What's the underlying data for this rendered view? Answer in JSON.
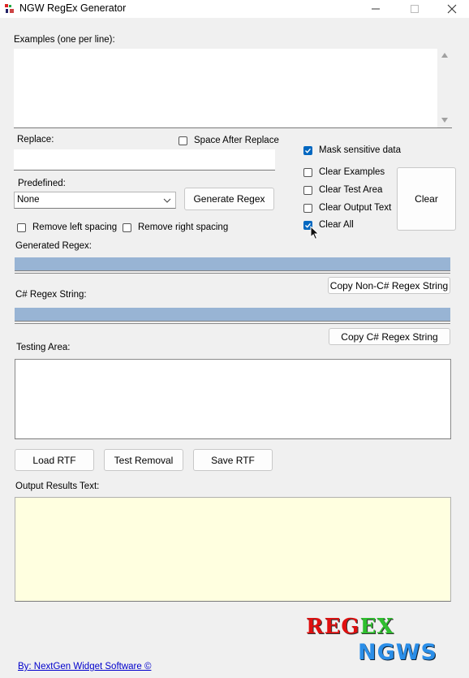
{
  "window": {
    "title": "NGW RegEx Generator"
  },
  "examples": {
    "label": "Examples (one per line):",
    "value": ""
  },
  "replace": {
    "label": "Replace:",
    "value": "",
    "space_after_label": "Space After Replace",
    "space_after_checked": false
  },
  "predefined": {
    "label": "Predefined:",
    "selected": "None"
  },
  "buttons": {
    "generate": "Generate Regex",
    "clear": "Clear",
    "copy_non_csharp": "Copy Non-C# Regex String",
    "copy_csharp": "Copy C# Regex String",
    "load_rtf": "Load RTF",
    "test_removal": "Test Removal",
    "save_rtf": "Save RTF"
  },
  "options": {
    "mask_sensitive": {
      "label": "Mask sensitive data",
      "checked": true
    },
    "clear_examples": {
      "label": "Clear Examples",
      "checked": false
    },
    "clear_test_area": {
      "label": "Clear Test Area",
      "checked": false
    },
    "clear_output_text": {
      "label": "Clear Output Text",
      "checked": false
    },
    "clear_all": {
      "label": "Clear All",
      "checked": true
    },
    "remove_left_spacing": {
      "label": "Remove left spacing",
      "checked": false
    },
    "remove_right_spacing": {
      "label": "Remove right spacing",
      "checked": false
    }
  },
  "generated_regex": {
    "label": "Generated Regex:",
    "value": ""
  },
  "csharp_regex": {
    "label": "C# Regex String:",
    "value": ""
  },
  "testing_area": {
    "label": "Testing Area:",
    "value": ""
  },
  "output_results": {
    "label": "Output Results Text:",
    "value": ""
  },
  "footer": {
    "credit": "By: NextGen Widget Software  ©",
    "logo_line1": "REGEX",
    "logo_line2": "NGWS"
  },
  "colors": {
    "checkbox_accent": "#0067c0",
    "regex_bar": "#98b4d4",
    "output_background": "#ffffe0",
    "link": "#0000cc"
  }
}
